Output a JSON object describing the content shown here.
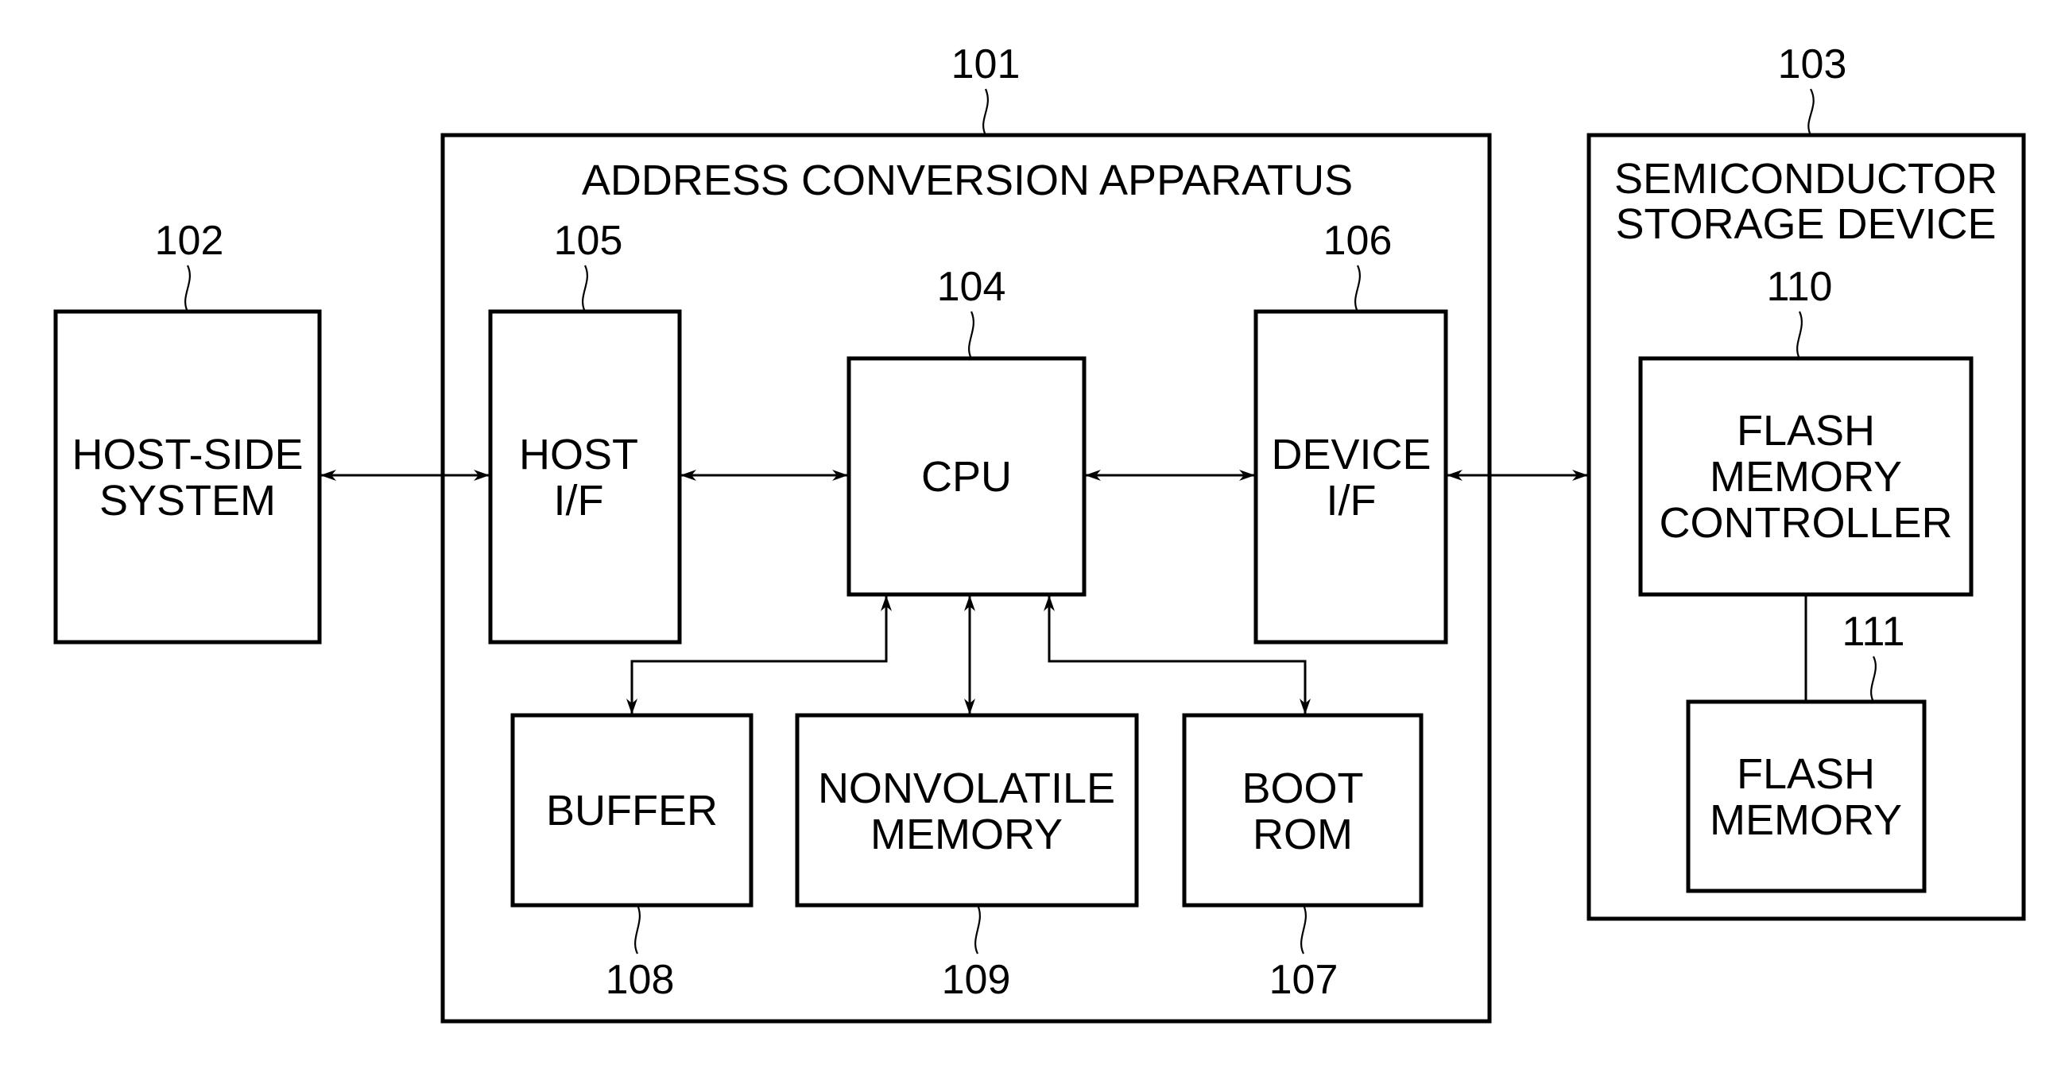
{
  "diagram": {
    "blocks": {
      "address_conversion_apparatus": {
        "ref": "101",
        "title": "ADDRESS CONVERSION APPARATUS"
      },
      "host_side_system": {
        "ref": "102",
        "lines": [
          "HOST-SIDE",
          "SYSTEM"
        ]
      },
      "semiconductor_storage_device": {
        "ref": "103",
        "lines": [
          "SEMICONDUCTOR",
          "STORAGE DEVICE"
        ]
      },
      "cpu": {
        "ref": "104",
        "lines": [
          "CPU"
        ]
      },
      "host_if": {
        "ref": "105",
        "lines": [
          "HOST",
          "I/F"
        ]
      },
      "device_if": {
        "ref": "106",
        "lines": [
          "DEVICE",
          "I/F"
        ]
      },
      "boot_rom": {
        "ref": "107",
        "lines": [
          "BOOT",
          "ROM"
        ]
      },
      "buffer": {
        "ref": "108",
        "lines": [
          "BUFFER"
        ]
      },
      "nonvolatile_memory": {
        "ref": "109",
        "lines": [
          "NONVOLATILE",
          "MEMORY"
        ]
      },
      "flash_memory_controller": {
        "ref": "110",
        "lines": [
          "FLASH",
          "MEMORY",
          "CONTROLLER"
        ]
      },
      "flash_memory": {
        "ref": "111",
        "lines": [
          "FLASH",
          "MEMORY"
        ]
      }
    },
    "connections": [
      {
        "from": "host_side_system",
        "to": "host_if",
        "type": "bidirectional"
      },
      {
        "from": "host_if",
        "to": "cpu",
        "type": "bidirectional"
      },
      {
        "from": "cpu",
        "to": "device_if",
        "type": "bidirectional"
      },
      {
        "from": "device_if",
        "to": "semiconductor_storage_device",
        "type": "bidirectional"
      },
      {
        "from": "cpu",
        "to": "buffer",
        "type": "bidirectional"
      },
      {
        "from": "cpu",
        "to": "nonvolatile_memory",
        "type": "bidirectional"
      },
      {
        "from": "cpu",
        "to": "boot_rom",
        "type": "bidirectional"
      },
      {
        "from": "flash_memory_controller",
        "to": "flash_memory",
        "type": "line"
      }
    ]
  }
}
